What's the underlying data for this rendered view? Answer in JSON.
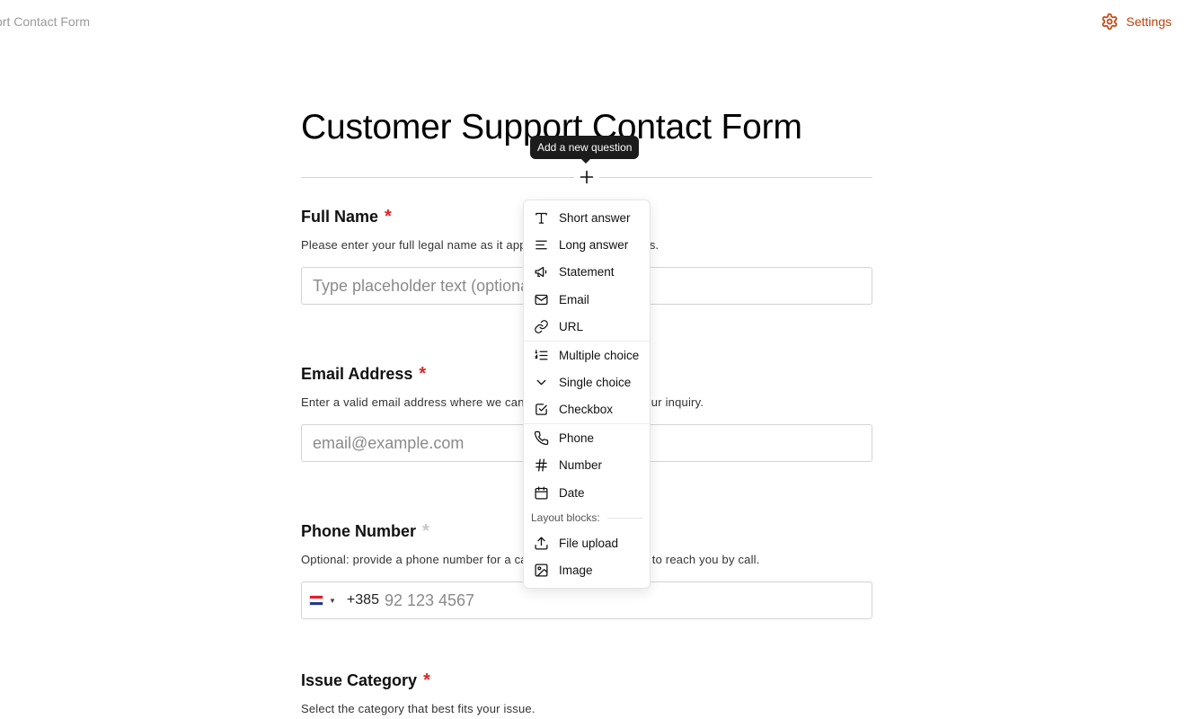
{
  "topbar": {
    "title": "ort Contact Form",
    "settings_label": "Settings",
    "accent": "#c2410c"
  },
  "form": {
    "title": "Customer Support Contact Form",
    "add_tooltip": "Add a new question",
    "questions": [
      {
        "label": "Full Name",
        "required_mark": "*",
        "description": "Please enter your full legal name as it appears on your documents.",
        "placeholder": "Type placeholder text (optional)"
      },
      {
        "label": "Email Address",
        "required_mark": "*",
        "description": "Enter a valid email address where we can reach you regarding your inquiry.",
        "placeholder": "email@example.com"
      },
      {
        "label": "Phone Number",
        "required_mark": "*",
        "description": "Optional: provide a phone number for a callback in case we need to reach you by call.",
        "dial_code": "+385",
        "placeholder": "92 123 4567"
      },
      {
        "label": "Issue Category",
        "required_mark": "*",
        "description": "Select the category that best fits your issue."
      }
    ]
  },
  "menu": {
    "items_group1": [
      {
        "label": "Short answer",
        "icon": "text-t-icon"
      },
      {
        "label": "Long answer",
        "icon": "align-left-icon"
      },
      {
        "label": "Statement",
        "icon": "megaphone-icon"
      },
      {
        "label": "Email",
        "icon": "mail-icon"
      },
      {
        "label": "URL",
        "icon": "link-icon"
      }
    ],
    "items_group2": [
      {
        "label": "Multiple choice",
        "icon": "list-ordered-icon"
      },
      {
        "label": "Single choice",
        "icon": "chevron-down-icon"
      },
      {
        "label": "Checkbox",
        "icon": "checkbox-icon"
      }
    ],
    "items_group3": [
      {
        "label": "Phone",
        "icon": "phone-icon"
      },
      {
        "label": "Number",
        "icon": "hash-icon"
      },
      {
        "label": "Date",
        "icon": "calendar-icon"
      }
    ],
    "layout_section_label": "Layout blocks:",
    "items_layout": [
      {
        "label": "File upload",
        "icon": "upload-icon"
      },
      {
        "label": "Image",
        "icon": "image-icon"
      }
    ]
  },
  "colors": {
    "required": "#dc2626",
    "optional_required": "#c7c7c7",
    "tooltip_bg": "#1c1c1c"
  }
}
